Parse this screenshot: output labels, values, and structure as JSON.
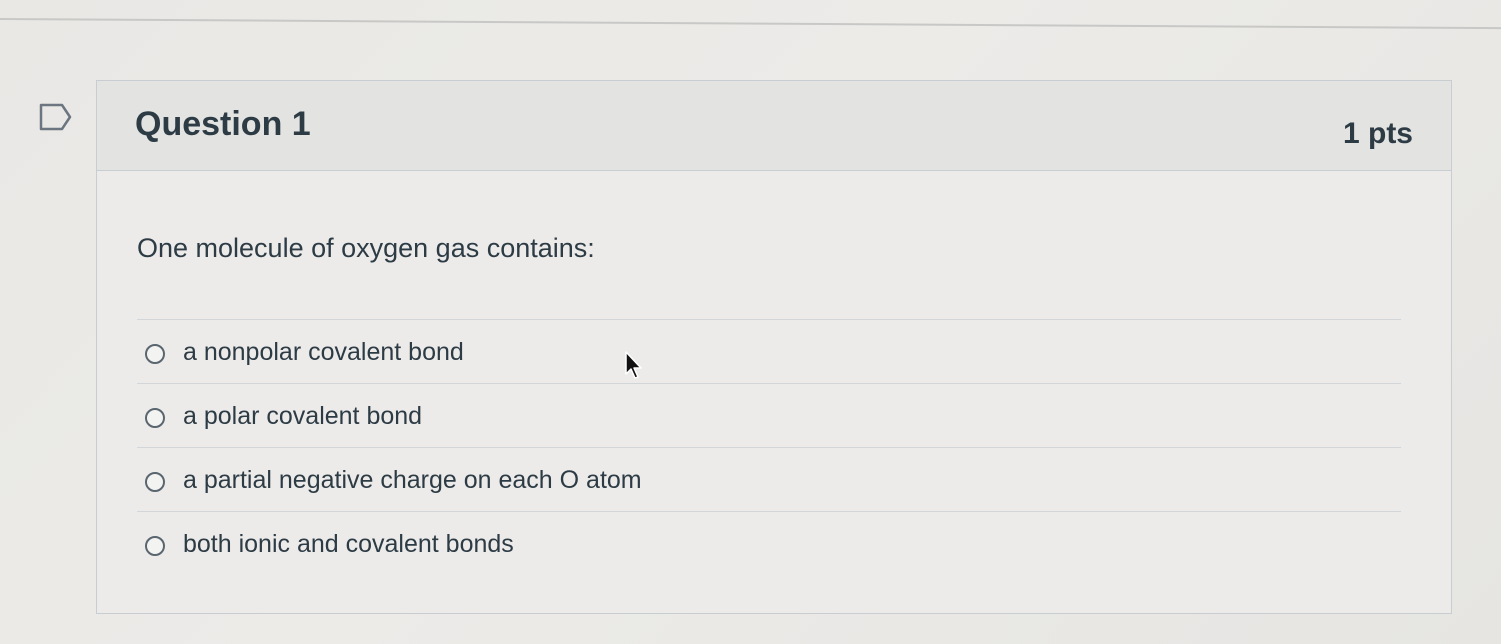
{
  "question": {
    "title": "Question 1",
    "points": "1 pts",
    "prompt": "One molecule of oxygen gas contains:",
    "flag_icon": "bookmark-flag-icon"
  },
  "answers": [
    {
      "label": "a nonpolar covalent bond",
      "selected": false
    },
    {
      "label": "a polar covalent bond",
      "selected": false
    },
    {
      "label": "a partial negative charge on each O atom",
      "selected": false
    },
    {
      "label": "both ionic and covalent bonds",
      "selected": false
    }
  ],
  "cursor": {
    "icon": "mouse-pointer-icon"
  },
  "colors": {
    "text": "#2d3b45",
    "border": "#c7cdd1",
    "header_bg": "#e3e3e1",
    "body_bg": "#ecebe9"
  }
}
